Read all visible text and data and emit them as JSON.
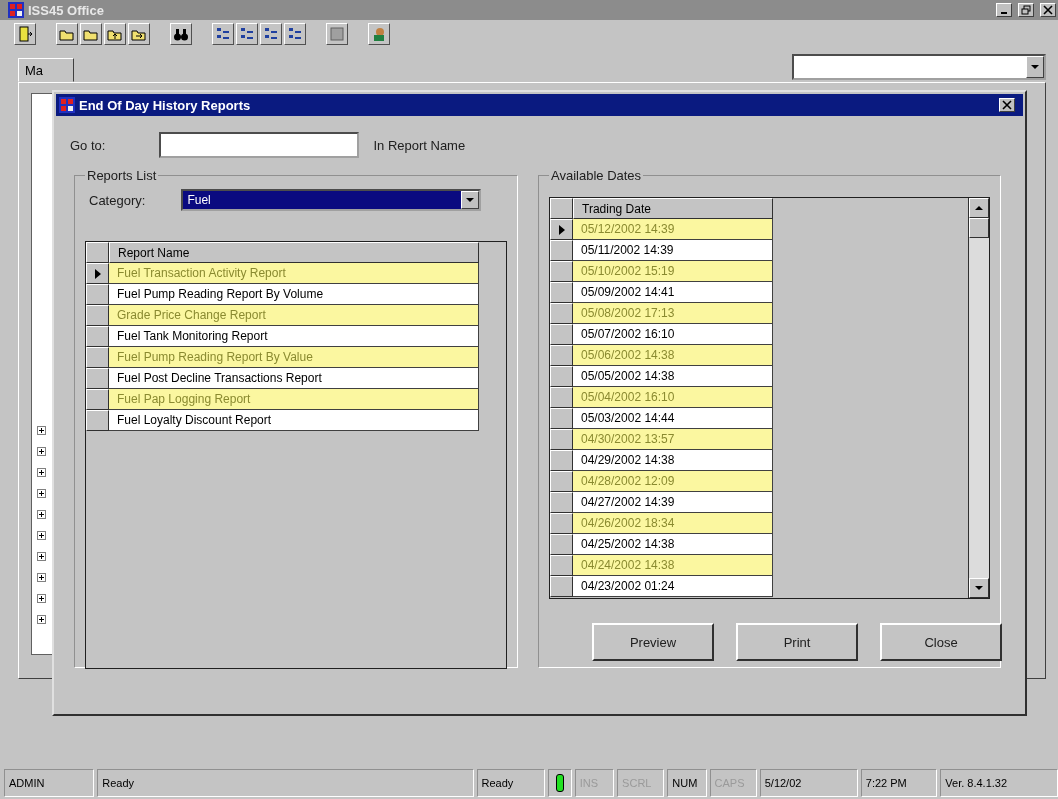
{
  "app": {
    "title": "ISS45 Office"
  },
  "main_tab": {
    "label": "Ma"
  },
  "dialog": {
    "title": "End Of Day History Reports",
    "goto_label": "Go to:",
    "goto_hint": "In Report Name",
    "reports": {
      "title": "Reports List",
      "category_label": "Category:",
      "category_value": "Fuel",
      "column": "Report Name",
      "rows": [
        {
          "name": "Fuel Transaction Activity Report",
          "selected": true,
          "highlighted": true
        },
        {
          "name": "Fuel Pump Reading Report By Volume",
          "selected": false,
          "highlighted": false
        },
        {
          "name": "Grade Price Change Report",
          "selected": false,
          "highlighted": true
        },
        {
          "name": "Fuel Tank Monitoring Report",
          "selected": false,
          "highlighted": false
        },
        {
          "name": "Fuel Pump Reading Report By Value",
          "selected": false,
          "highlighted": true
        },
        {
          "name": "Fuel Post Decline Transactions Report",
          "selected": false,
          "highlighted": false
        },
        {
          "name": "Fuel Pap Logging Report",
          "selected": false,
          "highlighted": true
        },
        {
          "name": "Fuel Loyalty Discount Report",
          "selected": false,
          "highlighted": false
        }
      ]
    },
    "dates": {
      "title": "Available Dates",
      "column": "Trading Date",
      "rows": [
        {
          "date": "05/12/2002 14:39",
          "selected": true,
          "highlighted": true
        },
        {
          "date": "05/11/2002 14:39",
          "selected": false,
          "highlighted": false
        },
        {
          "date": "05/10/2002 15:19",
          "selected": false,
          "highlighted": true
        },
        {
          "date": "05/09/2002 14:41",
          "selected": false,
          "highlighted": false
        },
        {
          "date": "05/08/2002 17:13",
          "selected": false,
          "highlighted": true
        },
        {
          "date": "05/07/2002 16:10",
          "selected": false,
          "highlighted": false
        },
        {
          "date": "05/06/2002 14:38",
          "selected": false,
          "highlighted": true
        },
        {
          "date": "05/05/2002 14:38",
          "selected": false,
          "highlighted": false
        },
        {
          "date": "05/04/2002 16:10",
          "selected": false,
          "highlighted": true
        },
        {
          "date": "05/03/2002 14:44",
          "selected": false,
          "highlighted": false
        },
        {
          "date": "04/30/2002 13:57",
          "selected": false,
          "highlighted": true
        },
        {
          "date": "04/29/2002 14:38",
          "selected": false,
          "highlighted": false
        },
        {
          "date": "04/28/2002 12:09",
          "selected": false,
          "highlighted": true
        },
        {
          "date": "04/27/2002 14:39",
          "selected": false,
          "highlighted": false
        },
        {
          "date": "04/26/2002 18:34",
          "selected": false,
          "highlighted": true
        },
        {
          "date": "04/25/2002 14:38",
          "selected": false,
          "highlighted": false
        },
        {
          "date": "04/24/2002 14:38",
          "selected": false,
          "highlighted": true
        },
        {
          "date": "04/23/2002 01:24",
          "selected": false,
          "highlighted": false
        }
      ]
    },
    "buttons": [
      "Preview",
      "Print",
      "Close"
    ]
  },
  "status_bar": [
    {
      "kind": "text",
      "text": "ADMIN",
      "disabled": false
    },
    {
      "kind": "text",
      "text": "Ready",
      "disabled": false
    },
    {
      "kind": "text",
      "text": "Ready",
      "disabled": false
    },
    {
      "kind": "light",
      "on": true
    },
    {
      "kind": "text",
      "text": "INS",
      "disabled": true
    },
    {
      "kind": "text",
      "text": "SCRL",
      "disabled": true
    },
    {
      "kind": "text",
      "text": "NUM",
      "disabled": false
    },
    {
      "kind": "text",
      "text": "CAPS",
      "disabled": true
    },
    {
      "kind": "text",
      "text": "5/12/02",
      "disabled": false
    },
    {
      "kind": "text",
      "text": "7:22 PM",
      "disabled": false
    },
    {
      "kind": "text",
      "text": "Ver. 8.4.1.32",
      "disabled": false
    }
  ]
}
